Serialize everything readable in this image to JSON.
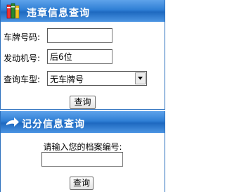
{
  "violation_query": {
    "title": "违章信息查询",
    "plate_label": "车牌号码:",
    "plate_value": "",
    "engine_label": "发动机号:",
    "engine_value": "后6位",
    "type_label": "查询车型:",
    "type_selected": "无车牌号",
    "submit_label": "查询"
  },
  "points_query": {
    "title": "记分信息查询",
    "instruction": "请输入您的档案编号:",
    "file_value": "",
    "submit_label": "查询"
  },
  "colors": {
    "header_blue": "#2f7fd5",
    "border_blue": "#2a6fbd"
  },
  "icons": {
    "header1": "books-icon",
    "header2": "arrow-right-icon",
    "select": "dropdown-arrow-icon"
  }
}
